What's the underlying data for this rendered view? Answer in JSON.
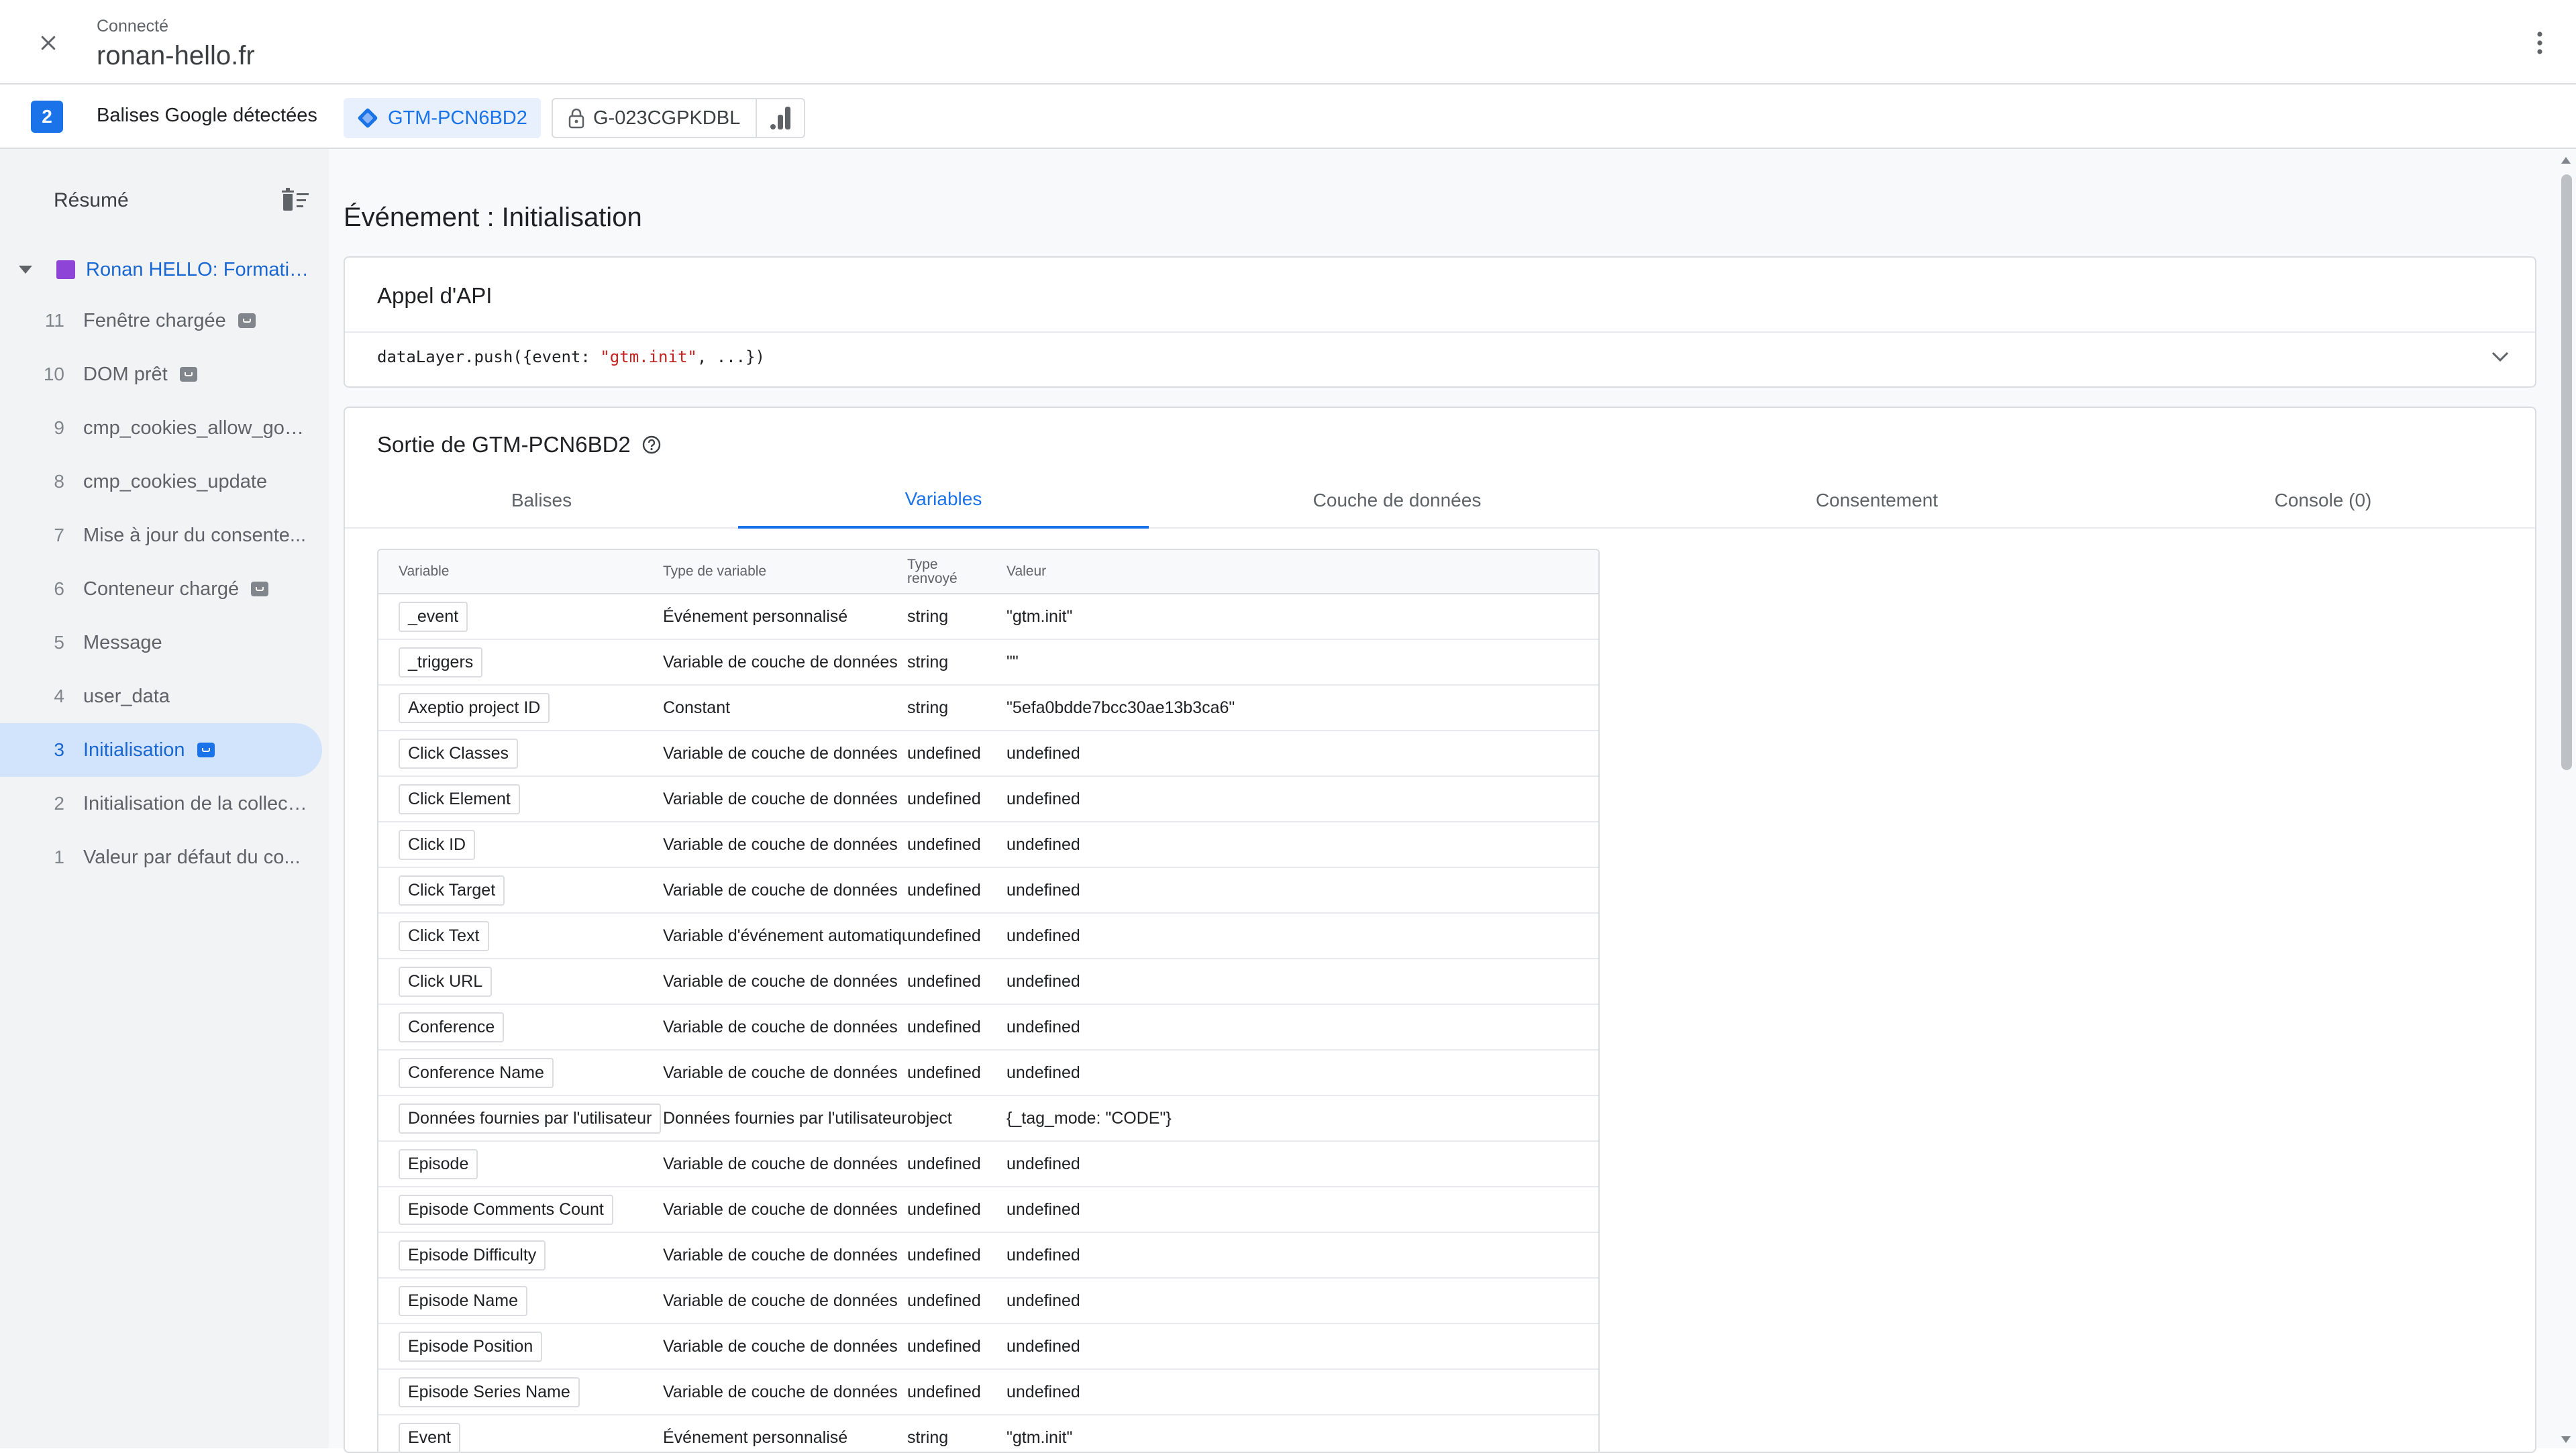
{
  "header": {
    "status": "Connecté",
    "domain": "ronan-hello.fr"
  },
  "tagbar": {
    "count": "2",
    "title": "Balises Google détectées",
    "gtm_id": "GTM-PCN6BD2",
    "ga_id": "G-023CGPKDBL"
  },
  "sidebar": {
    "heading": "Résumé",
    "container": "Ronan HELLO: Formatio...",
    "events": [
      {
        "num": "11",
        "label": "Fenêtre chargée",
        "badge": true,
        "active": false
      },
      {
        "num": "10",
        "label": "DOM prêt",
        "badge": true,
        "active": false
      },
      {
        "num": "9",
        "label": "cmp_cookies_allow_goo...",
        "badge": false,
        "active": false
      },
      {
        "num": "8",
        "label": "cmp_cookies_update",
        "badge": false,
        "active": false
      },
      {
        "num": "7",
        "label": "Mise à jour du consente...",
        "badge": false,
        "active": false
      },
      {
        "num": "6",
        "label": "Conteneur chargé",
        "badge": true,
        "active": false
      },
      {
        "num": "5",
        "label": "Message",
        "badge": false,
        "active": false
      },
      {
        "num": "4",
        "label": "user_data",
        "badge": false,
        "active": false
      },
      {
        "num": "3",
        "label": "Initialisation",
        "badge": true,
        "active": true
      },
      {
        "num": "2",
        "label": "Initialisation de la collect...",
        "badge": false,
        "active": false
      },
      {
        "num": "1",
        "label": "Valeur par défaut du co...",
        "badge": false,
        "active": false
      }
    ]
  },
  "main": {
    "page_title": "Événement : Initialisation",
    "api_card": {
      "title": "Appel d'API",
      "code_prefix": "dataLayer.push({event: ",
      "code_string": "\"gtm.init\"",
      "code_suffix": ", ...})"
    },
    "output": {
      "title": "Sortie de GTM-PCN6BD2",
      "tabs": [
        "Balises",
        "Variables",
        "Couche de données",
        "Consentement",
        "Console (0)"
      ],
      "active_tab": "Variables",
      "table": {
        "headers": {
          "variable": "Variable",
          "type": "Type de variable",
          "returned_line1": "Type",
          "returned_line2": "renvoyé",
          "value": "Valeur"
        },
        "rows": [
          {
            "name": "_event",
            "type": "Événement personnalisé",
            "ret": "string",
            "value": "\"gtm.init\""
          },
          {
            "name": "_triggers",
            "type": "Variable de couche de données",
            "ret": "string",
            "value": "\"\""
          },
          {
            "name": "Axeptio project ID",
            "type": "Constant",
            "ret": "string",
            "value": "\"5efa0bdde7bcc30ae13b3ca6\""
          },
          {
            "name": "Click Classes",
            "type": "Variable de couche de données",
            "ret": "undefined",
            "value": "undefined"
          },
          {
            "name": "Click Element",
            "type": "Variable de couche de données",
            "ret": "undefined",
            "value": "undefined"
          },
          {
            "name": "Click ID",
            "type": "Variable de couche de données",
            "ret": "undefined",
            "value": "undefined"
          },
          {
            "name": "Click Target",
            "type": "Variable de couche de données",
            "ret": "undefined",
            "value": "undefined"
          },
          {
            "name": "Click Text",
            "type": "Variable d'événement automatique",
            "ret": "undefined",
            "value": "undefined"
          },
          {
            "name": "Click URL",
            "type": "Variable de couche de données",
            "ret": "undefined",
            "value": "undefined"
          },
          {
            "name": "Conference",
            "type": "Variable de couche de données",
            "ret": "undefined",
            "value": "undefined"
          },
          {
            "name": "Conference Name",
            "type": "Variable de couche de données",
            "ret": "undefined",
            "value": "undefined"
          },
          {
            "name": "Données fournies par l'utilisateur",
            "type": "Données fournies par l'utilisateur",
            "ret": "object",
            "value": "{_tag_mode: \"CODE\"}"
          },
          {
            "name": "Episode",
            "type": "Variable de couche de données",
            "ret": "undefined",
            "value": "undefined"
          },
          {
            "name": "Episode Comments Count",
            "type": "Variable de couche de données",
            "ret": "undefined",
            "value": "undefined"
          },
          {
            "name": "Episode Difficulty",
            "type": "Variable de couche de données",
            "ret": "undefined",
            "value": "undefined"
          },
          {
            "name": "Episode Name",
            "type": "Variable de couche de données",
            "ret": "undefined",
            "value": "undefined"
          },
          {
            "name": "Episode Position",
            "type": "Variable de couche de données",
            "ret": "undefined",
            "value": "undefined"
          },
          {
            "name": "Episode Series Name",
            "type": "Variable de couche de données",
            "ret": "undefined",
            "value": "undefined"
          },
          {
            "name": "Event",
            "type": "Événement personnalisé",
            "ret": "string",
            "value": "\"gtm.init\""
          }
        ]
      }
    }
  },
  "colors": {
    "accent": "#1a73e8",
    "active_bg": "#d2e3fc",
    "container": "#8e44d6",
    "code_string": "#c5221f"
  }
}
